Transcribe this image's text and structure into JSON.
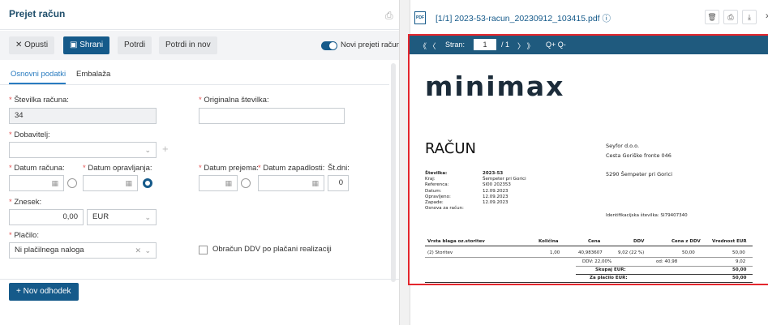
{
  "form": {
    "title": "Prejet račun",
    "toolbar": {
      "cancel": "✕  Opusti",
      "save": "▣  Shrani",
      "confirm": "Potrdi",
      "confirm_new": "Potrdi in nov",
      "toggle_label": "Novi prejeti računi"
    },
    "tabs": [
      "Osnovni podatki",
      "Embalaža"
    ],
    "fields": {
      "invoice_number_label": "Številka računa:",
      "invoice_number_value": "34",
      "original_number_label": "Originalna številka:",
      "original_number_value": "",
      "supplier_label": "Dobavitelj:",
      "supplier_value": "",
      "invoice_date_label": "Datum računa:",
      "service_date_label": "Datum opravljanja:",
      "receipt_date_label": "Datum prejema:",
      "due_date_label": "Datum zapadlosti:",
      "days_label": "Št.dni:",
      "days_value": "0",
      "amount_label": "Znesek:",
      "amount_value": "0,00",
      "currency_value": "EUR",
      "payment_label": "Plačilo:",
      "payment_value": "Ni plačilnega naloga",
      "vat_checkbox_label": "Obračun DDV po plačani realizaciji"
    },
    "new_line_button": "+  Nov odhodek"
  },
  "pdf": {
    "filename": "[1/1] 2023-53-racun_20230912_103415.pdf",
    "toolbar": {
      "nav_prev": "《  〈",
      "page_label": "Stran:",
      "page_value": "1",
      "page_total": "/ 1",
      "nav_next": "〉  》",
      "zoom": "Q+  Q-"
    },
    "doc": {
      "logo": "minimax",
      "title": "RAČUN",
      "company_name": "Seyfor d.o.o.",
      "company_street": "Cesta Goriške fronte 046",
      "company_city": "5290    Šempeter pri Gorici",
      "meta_labels": [
        "Številka:",
        "Kraj:",
        "Referenca:",
        "Datum:",
        "Opravljeno:",
        "Zapade:",
        "Osnova za račun:"
      ],
      "meta_values": [
        "2023-53",
        "Šempeter pri Gorici",
        "SI00 202353",
        "12.09.2023",
        "12.09.2023",
        "12.09.2023",
        ""
      ],
      "vat_id": "Identifikacijska številka: SI79407340",
      "table_headers": [
        "Vrsta blaga oz.storitev",
        "Količina",
        "Cena",
        "DDV",
        "Cena z DDV",
        "Vrednost EUR"
      ],
      "row": [
        "(2) Storitev",
        "1,00",
        "40,983607",
        "9,02 (22 %)",
        "50,00",
        "50,00"
      ],
      "summary": {
        "ddv_label": "DDV: 22,00%",
        "ddv_base": "od: 40,98",
        "ddv_value": "9,02",
        "total_label": "Skupaj EUR:",
        "total_value": "50,00",
        "pay_label": "Za plačilo EUR:",
        "pay_value": "50,00"
      }
    }
  }
}
